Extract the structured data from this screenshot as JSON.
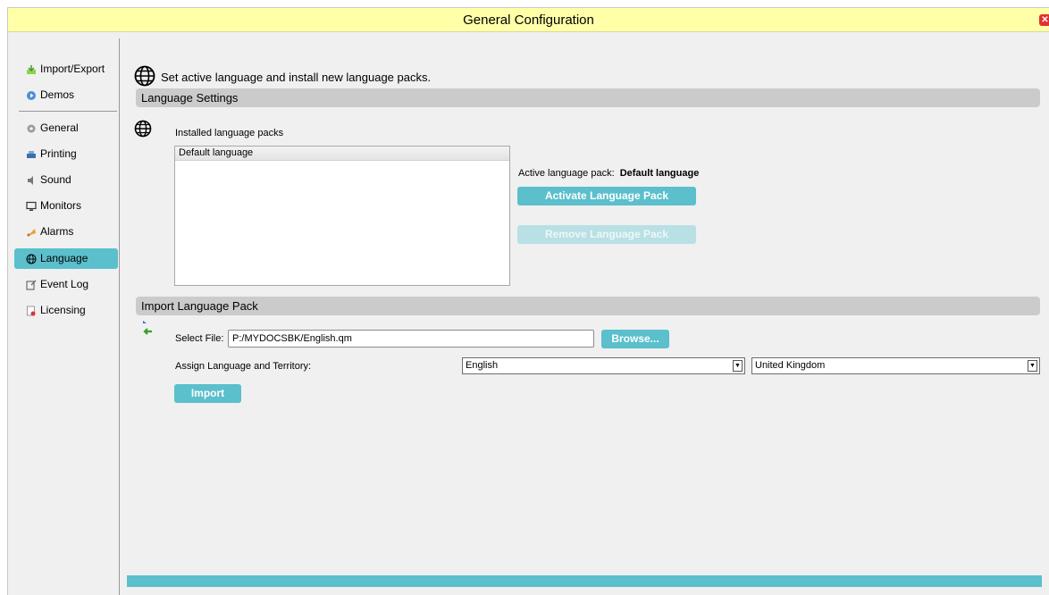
{
  "window": {
    "title": "General Configuration",
    "close_icon": "close-icon"
  },
  "sidebar": {
    "items": [
      {
        "label": "Import/Export",
        "icon": "import-export-icon"
      },
      {
        "label": "Demos",
        "icon": "demos-icon"
      },
      {
        "label": "General",
        "icon": "gear-icon"
      },
      {
        "label": "Printing",
        "icon": "printer-icon"
      },
      {
        "label": "Sound",
        "icon": "speaker-icon"
      },
      {
        "label": "Monitors",
        "icon": "monitor-icon"
      },
      {
        "label": "Alarms",
        "icon": "alarm-icon"
      },
      {
        "label": "Language",
        "icon": "globe-icon",
        "active": true
      },
      {
        "label": "Event Log",
        "icon": "event-log-icon"
      },
      {
        "label": "Licensing",
        "icon": "licensing-icon"
      }
    ]
  },
  "main": {
    "intro": "Set active language and install new language packs.",
    "language_settings": {
      "header": "Language Settings",
      "installed_label": "Installed language packs",
      "installed_packs": [
        "Default language"
      ],
      "active_label": "Active language pack:",
      "active_value": "Default language",
      "activate_button": "Activate Language Pack",
      "remove_button": "Remove Language Pack"
    },
    "import_pack": {
      "header": "Import Language Pack",
      "select_file_label": "Select File:",
      "file_path": "P:/MYDOCSBK/English.qm",
      "browse_button": "Browse...",
      "assign_label": "Assign Language and Territory:",
      "language_value": "English",
      "territory_value": "United Kingdom",
      "import_button": "Import"
    }
  },
  "colors": {
    "accent": "#5bbfcc",
    "title_bg": "#ffffa8",
    "section_bg": "#cbcbcb"
  }
}
